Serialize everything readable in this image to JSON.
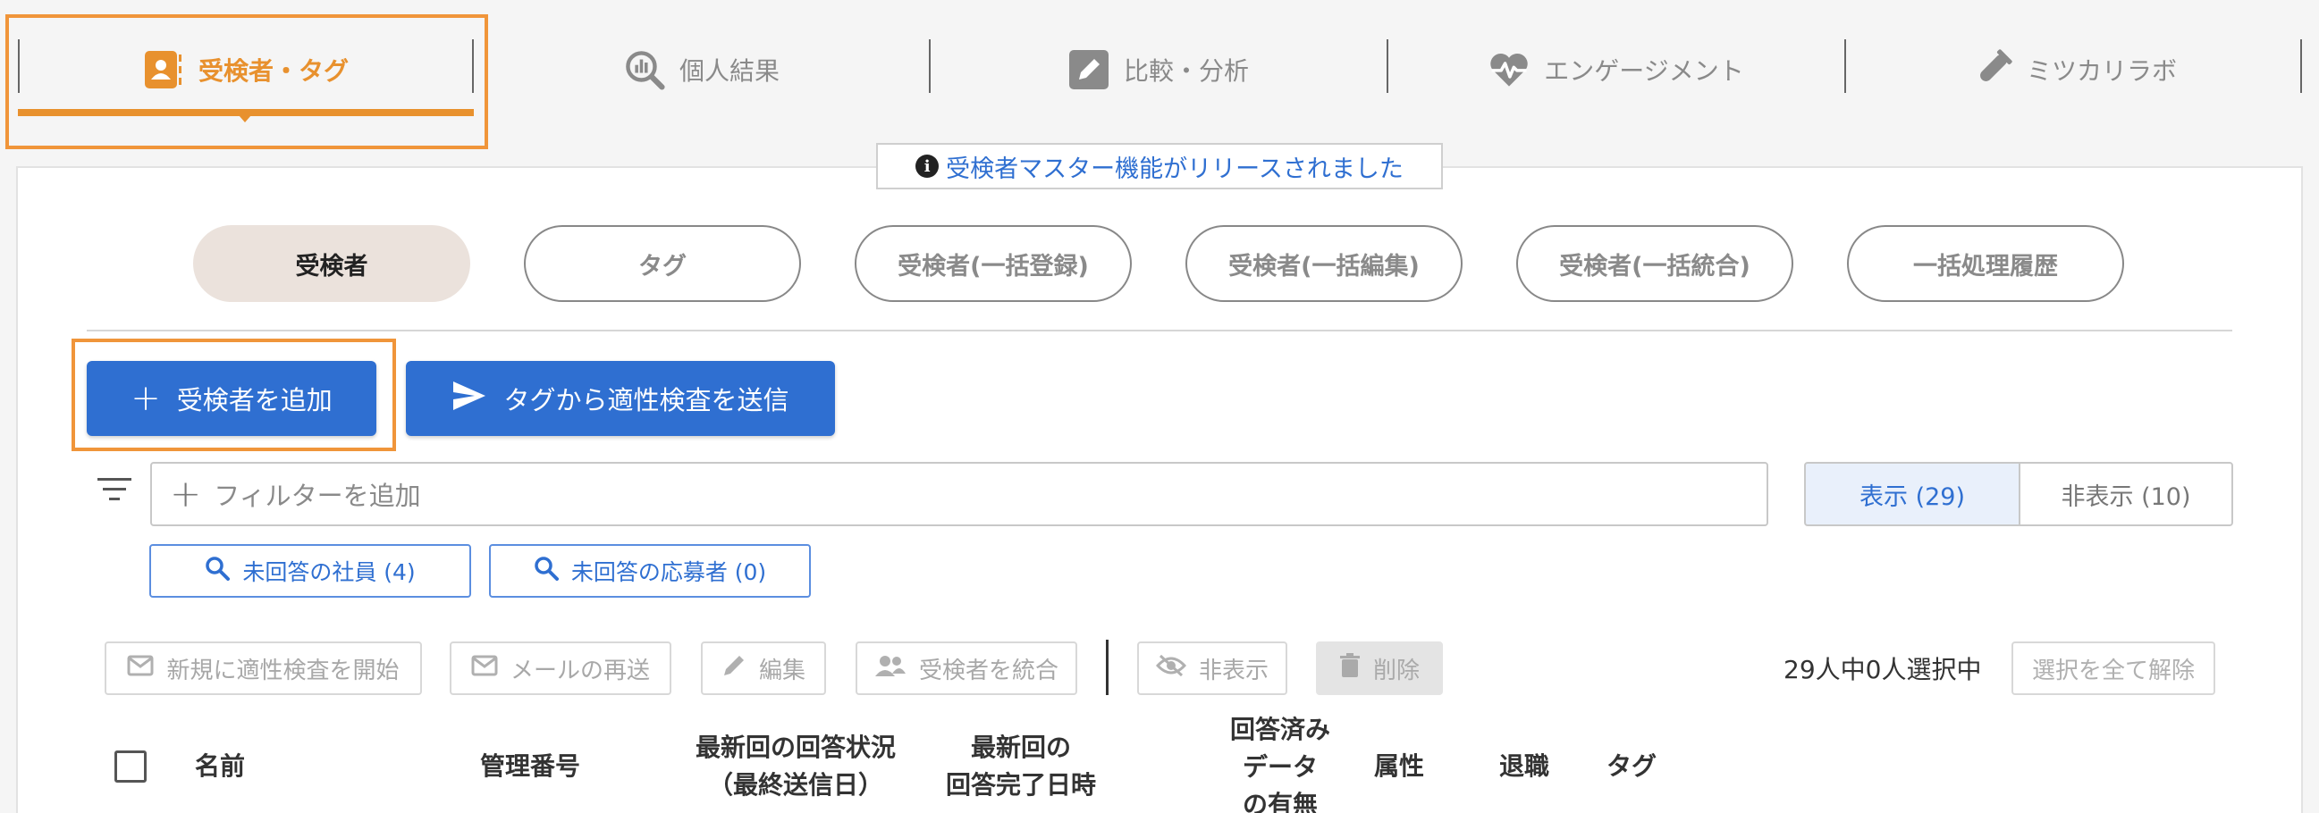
{
  "tabs": [
    {
      "label": "受検者・タグ",
      "icon": "person-tag-icon",
      "active": true
    },
    {
      "label": "個人結果",
      "icon": "chart-search-icon",
      "active": false
    },
    {
      "label": "比較・分析",
      "icon": "pencil-icon",
      "active": false
    },
    {
      "label": "エンゲージメント",
      "icon": "heartbeat-icon",
      "active": false
    },
    {
      "label": "ミツカリラボ",
      "icon": "test-tube-icon",
      "active": false
    }
  ],
  "notice": {
    "text": "受検者マスター機能がリリースされました",
    "icon": "info-icon"
  },
  "subtabs": [
    {
      "label": "受検者",
      "active": true
    },
    {
      "label": "タグ"
    },
    {
      "label": "受検者(一括登録)"
    },
    {
      "label": "受検者(一括編集)"
    },
    {
      "label": "受検者(一括統合)"
    },
    {
      "label": "一括処理履歴"
    }
  ],
  "primary_buttons": {
    "add_examinee": "受検者を追加",
    "send_from_tag": "タグから適性検査を送信"
  },
  "filter": {
    "placeholder": "フィルターを追加",
    "show_label": "表示 (29)",
    "hide_label": "非表示 (10)"
  },
  "quick_filters": [
    {
      "label": "未回答の社員 (4)"
    },
    {
      "label": "未回答の応募者 (0)"
    }
  ],
  "actions": {
    "new_test": "新規に適性検査を開始",
    "resend_mail": "メールの再送",
    "edit": "編集",
    "merge": "受検者を統合",
    "hide": "非表示",
    "delete": "削除",
    "clear_selection": "選択を全て解除"
  },
  "selection_status": "29人中0人選択中",
  "table_headers": {
    "name": "名前",
    "management_no": "管理番号",
    "latest_status_1": "最新回の回答状況",
    "latest_status_2": "（最終送信日）",
    "latest_completed_1": "最新回の",
    "latest_completed_2": "回答完了日時",
    "answered_data_1": "回答済み",
    "answered_data_2": "データ",
    "answered_data_3": "の有無",
    "attribute": "属性",
    "retired": "退職",
    "tag": "タグ"
  },
  "colors": {
    "accent_orange": "#e8912e",
    "primary_blue": "#2f6fd1"
  }
}
